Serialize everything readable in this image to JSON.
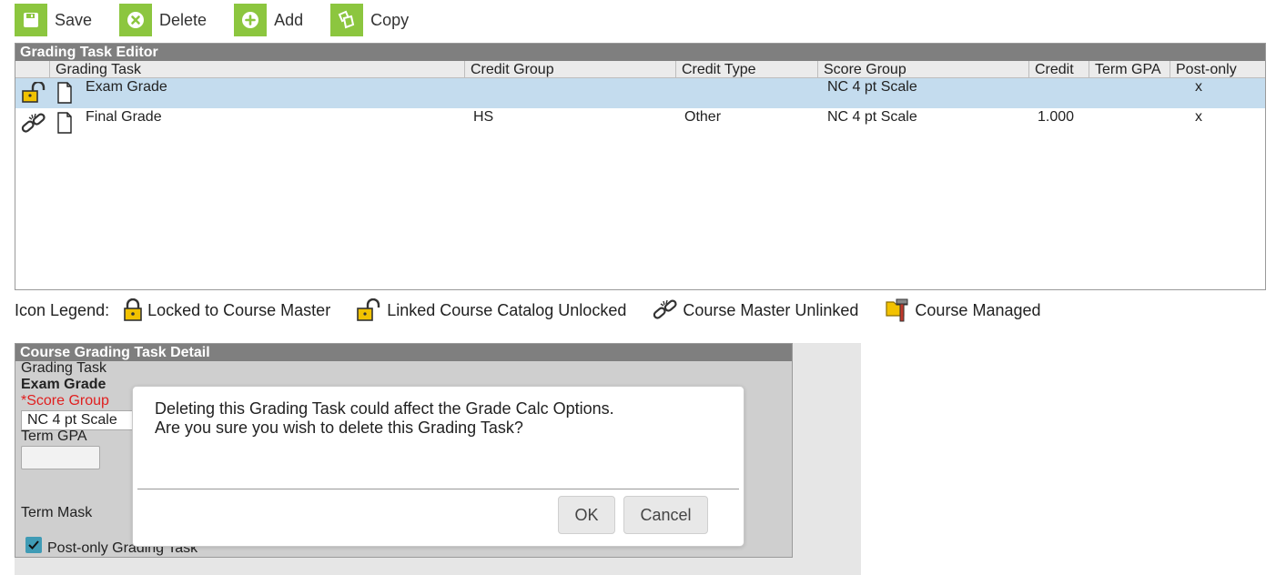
{
  "toolbar": {
    "save": "Save",
    "delete": "Delete",
    "add": "Add",
    "copy": "Copy",
    "accent": "#8cc63f"
  },
  "editor": {
    "title": "Grading Task Editor",
    "columns": [
      "Grading Task",
      "Credit Group",
      "Credit Type",
      "Score Group",
      "Credit",
      "Term GPA",
      "Post-only"
    ],
    "rows": [
      {
        "status_icon": "lock-open-icon",
        "grading_task": "Exam Grade",
        "credit_group": "",
        "credit_type": "",
        "score_group": "NC 4 pt Scale",
        "credit": "",
        "term_gpa": "",
        "post_only": "x",
        "selected": true
      },
      {
        "status_icon": "broken-link-icon",
        "grading_task": "Final Grade",
        "credit_group": "HS",
        "credit_type": "Other",
        "score_group": "NC 4 pt Scale",
        "credit": "1.000",
        "term_gpa": "",
        "post_only": "x",
        "selected": false
      }
    ],
    "selected_color": "#c4dcee"
  },
  "legend": {
    "title": "Icon Legend:",
    "items": [
      {
        "icon": "lock-closed-icon",
        "label": "Locked to Course Master"
      },
      {
        "icon": "lock-open-icon",
        "label": "Linked Course Catalog Unlocked"
      },
      {
        "icon": "broken-link-icon",
        "label": "Course Master Unlinked"
      },
      {
        "icon": "course-managed-icon",
        "label": "Course Managed"
      }
    ]
  },
  "detail": {
    "title": "Course Grading Task Detail",
    "grading_task_label": "Grading Task",
    "grading_task_value": "Exam Grade",
    "score_group_label": "*Score Group",
    "score_group_value": "NC 4 pt Scale",
    "term_gpa_label": "Term GPA",
    "term_gpa_value": "",
    "term_mask_label": "Term Mask",
    "post_only_label": "Post-only Grading Task",
    "post_only_checked": true,
    "required_color": "#e02020"
  },
  "dialog": {
    "line1": "Deleting this Grading Task could affect the Grade Calc Options.",
    "line2": "Are you sure you wish to delete this Grading Task?",
    "ok": "OK",
    "cancel": "Cancel"
  }
}
